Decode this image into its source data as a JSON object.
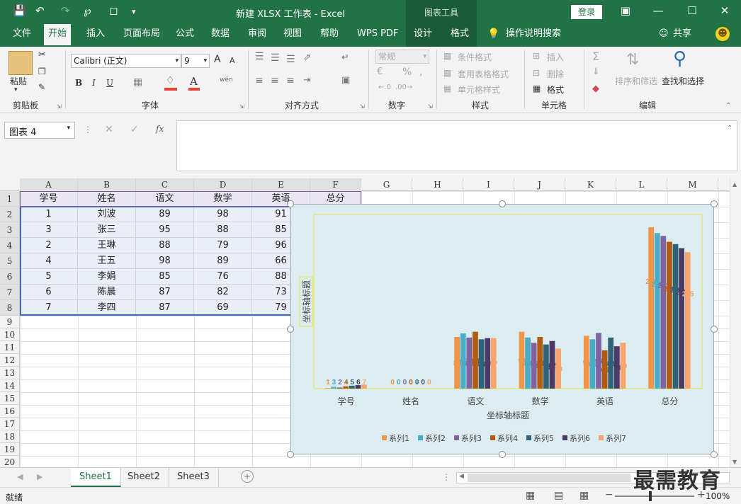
{
  "window": {
    "title": "新建 XLSX 工作表  -  Excel",
    "chart_tools": "图表工具",
    "login": "登录"
  },
  "menu": {
    "items": [
      "文件",
      "开始",
      "插入",
      "页面布局",
      "公式",
      "数据",
      "审阅",
      "视图",
      "帮助",
      "WPS PDF",
      "设计",
      "格式"
    ],
    "tellme": "操作说明搜索",
    "share": "共享"
  },
  "ribbon": {
    "clipboard": {
      "paste": "粘贴",
      "label": "剪贴板"
    },
    "font": {
      "name": "Calibri (正文)",
      "size": "9",
      "label": "字体",
      "bold": "B",
      "italic": "I",
      "underline": "U",
      "grow": "A",
      "shrink": "A",
      "color_a": "A",
      "wen": "wén"
    },
    "align": {
      "label": "对齐方式"
    },
    "number": {
      "format": "常规",
      "label": "数字",
      "pct": "%",
      "comma": ","
    },
    "styles": {
      "cond": "条件格式",
      "table": "套用表格格式",
      "cell": "单元格样式",
      "label": "样式"
    },
    "cells": {
      "insert": "插入",
      "delete": "删除",
      "format": "格式",
      "label": "单元格"
    },
    "edit": {
      "sort": "排序和筛选",
      "find": "查找和选择",
      "label": "编辑"
    }
  },
  "formula_bar": {
    "namebox": "图表 4",
    "fx": "fx"
  },
  "grid": {
    "columns": [
      "A",
      "B",
      "C",
      "D",
      "E",
      "F",
      "G",
      "H",
      "I",
      "J",
      "K",
      "L",
      "M"
    ],
    "rows": [
      "1",
      "2",
      "3",
      "4",
      "5",
      "6",
      "7",
      "8",
      "9",
      "10",
      "11",
      "12",
      "13",
      "14",
      "15",
      "16",
      "17",
      "18",
      "19",
      "20"
    ],
    "header": [
      "学号",
      "姓名",
      "语文",
      "数学",
      "英语",
      "总分"
    ],
    "data": [
      [
        "1",
        "刘波",
        "89",
        "98",
        "91"
      ],
      [
        "3",
        "张三",
        "95",
        "88",
        "85"
      ],
      [
        "2",
        "王琳",
        "88",
        "79",
        "96"
      ],
      [
        "4",
        "王五",
        "98",
        "89",
        "66"
      ],
      [
        "5",
        "李娟",
        "85",
        "76",
        "88"
      ],
      [
        "6",
        "陈晨",
        "87",
        "82",
        "73"
      ],
      [
        "7",
        "李四",
        "87",
        "69",
        "79"
      ]
    ]
  },
  "chart_data": {
    "type": "bar",
    "categories": [
      "学号",
      "姓名",
      "语文",
      "数学",
      "英语",
      "总分"
    ],
    "series": [
      {
        "name": "系列1",
        "values": [
          1,
          0,
          89,
          98,
          91,
          278
        ]
      },
      {
        "name": "系列2",
        "values": [
          3,
          0,
          95,
          88,
          85,
          268
        ]
      },
      {
        "name": "系列3",
        "values": [
          2,
          0,
          88,
          79,
          96,
          263
        ]
      },
      {
        "name": "系列4",
        "values": [
          4,
          0,
          98,
          89,
          66,
          253
        ]
      },
      {
        "name": "系列5",
        "values": [
          5,
          0,
          85,
          76,
          88,
          249
        ]
      },
      {
        "name": "系列6",
        "values": [
          6,
          0,
          87,
          82,
          73,
          242
        ]
      },
      {
        "name": "系列7",
        "values": [
          7,
          0,
          87,
          69,
          79,
          235
        ]
      }
    ],
    "xlabel": "坐标轴标题",
    "ylabel": "坐标轴标题",
    "ylim": [
      0,
      300
    ],
    "legend": "bottom",
    "colors": [
      "#f0954a",
      "#4bacc6",
      "#8064a2",
      "#b05a14",
      "#2f6478",
      "#4b3a67",
      "#f7a46e"
    ]
  },
  "sheets": {
    "tabs": [
      "Sheet1",
      "Sheet2",
      "Sheet3"
    ],
    "active": "Sheet1",
    "add": "+"
  },
  "status": {
    "ready": "就绪",
    "zoom": "100%",
    "watermark": "最需教育"
  }
}
